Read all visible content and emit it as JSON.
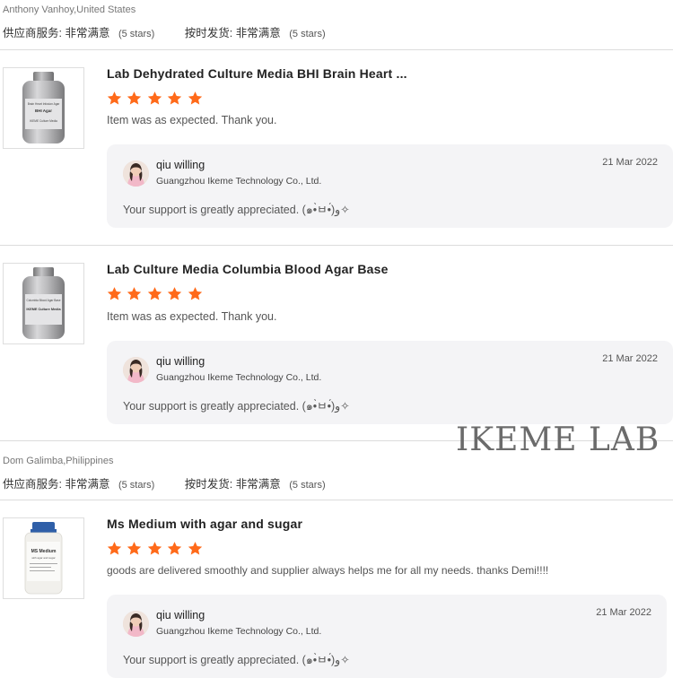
{
  "reviewers": [
    {
      "name": "Anthony Vanhoy,United States",
      "ratings": [
        {
          "label": "供应商服务:",
          "value": "非常满意",
          "stars_text": "(5 stars)"
        },
        {
          "label": "按时发货:",
          "value": "非常满意",
          "stars_text": "(5 stars)"
        }
      ]
    },
    {
      "name": "Dom Galimba,Philippines",
      "ratings": [
        {
          "label": "供应商服务:",
          "value": "非常满意",
          "stars_text": "(5 stars)"
        },
        {
          "label": "按时发货:",
          "value": "非常满意",
          "stars_text": "(5 stars)"
        }
      ]
    }
  ],
  "reviews": [
    {
      "product_title": "Lab Dehydrated Culture Media BHI Brain Heart ...",
      "thumb_lines": [
        "Brain Heart Infusion Agar",
        "BHI Agar",
        "IKEME Culture Media"
      ],
      "rating": 5,
      "comment": "Item was as expected. Thank you.",
      "reply": {
        "author": "qiu willing",
        "company": "Guangzhou Ikeme Technology Co., Ltd.",
        "date": "21 Mar 2022",
        "text": "Your support is greatly appreciated. (๑•̀ㅂ•́)و✧"
      }
    },
    {
      "product_title": "Lab Culture Media Columbia Blood Agar Base",
      "thumb_lines": [
        "Columbia Blood Agar Base",
        "",
        "IKEME Culture Media"
      ],
      "rating": 5,
      "comment": "Item was as expected. Thank you.",
      "reply": {
        "author": "qiu willing",
        "company": "Guangzhou Ikeme Technology Co., Ltd.",
        "date": "21 Mar 2022",
        "text": "Your support is greatly appreciated. (๑•̀ㅂ•́)و✧"
      }
    },
    {
      "product_title": "Ms Medium with agar and sugar",
      "thumb_lines": [
        "MS Medium",
        "with agar and sugar"
      ],
      "rating": 5,
      "comment": "goods are delivered smoothly and supplier always helps me for all my needs. thanks Demi!!!!",
      "reply": {
        "author": "qiu willing",
        "company": "Guangzhou Ikeme Technology Co., Ltd.",
        "date": "21 Mar 2022",
        "text": "Your support is greatly appreciated. (๑•̀ㅂ•́)و✧"
      }
    }
  ],
  "watermark": "IKEME LAB",
  "colors": {
    "star": "#ff6a1a",
    "reply_bg": "#f4f4f6",
    "divider": "#dcdcdc"
  }
}
